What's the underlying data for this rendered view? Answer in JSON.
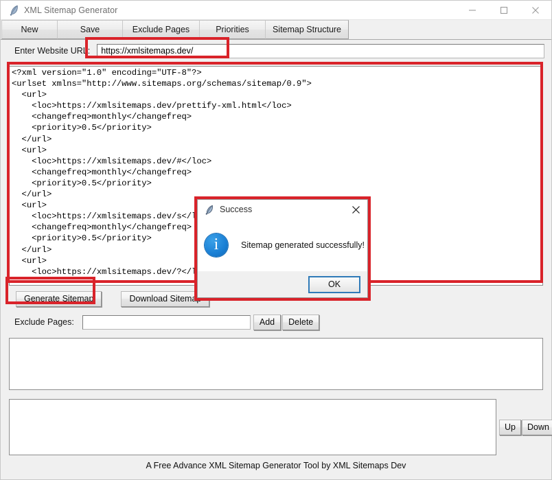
{
  "window": {
    "title": "XML Sitemap Generator",
    "icon": "feather-icon",
    "controls": {
      "minimize": "minimize-icon",
      "maximize": "maximize-icon",
      "close": "close-icon"
    }
  },
  "tabs": [
    {
      "label": "New"
    },
    {
      "label": "Save"
    },
    {
      "label": "Exclude Pages"
    },
    {
      "label": "Priorities"
    },
    {
      "label": "Sitemap Structure"
    }
  ],
  "url_row": {
    "label": "Enter Website URL:",
    "value": "https://xmlsitemaps.dev/",
    "placeholder": ""
  },
  "xml_output": {
    "content": "<?xml version=\"1.0\" encoding=\"UTF-8\"?>\n<urlset xmlns=\"http://www.sitemaps.org/schemas/sitemap/0.9\">\n  <url>\n    <loc>https://xmlsitemaps.dev/prettify-xml.html</loc>\n    <changefreq>monthly</changefreq>\n    <priority>0.5</priority>\n  </url>\n  <url>\n    <loc>https://xmlsitemaps.dev/#</loc>\n    <changefreq>monthly</changefreq>\n    <priority>0.5</priority>\n  </url>\n  <url>\n    <loc>https://xmlsitemaps.dev/s</loc>\n    <changefreq>monthly</changefreq>\n    <priority>0.5</priority>\n  </url>\n  <url>\n    <loc>https://xmlsitemaps.dev/?</loc>"
  },
  "actions": {
    "generate_label": "Generate Sitemap",
    "download_label": "Download Sitemap"
  },
  "exclude_row": {
    "label": "Exclude Pages:",
    "value": "",
    "placeholder": "",
    "add_label": "Add",
    "delete_label": "Delete"
  },
  "reorder": {
    "up_label": "Up",
    "down_label": "Down"
  },
  "footer": {
    "text": "A Free Advance XML Sitemap Generator Tool by XML Sitemaps Dev"
  },
  "dialog": {
    "title": "Success",
    "icon": "feather-icon",
    "close_icon": "close-icon",
    "info_icon": "info-icon",
    "message": "Sitemap generated successfully!",
    "ok_label": "OK"
  },
  "colors": {
    "annotation_red": "#d9232a",
    "info_blue": "#1a7fd4",
    "focus_blue": "#2f7ab8",
    "window_bg": "#f0f0f0"
  }
}
